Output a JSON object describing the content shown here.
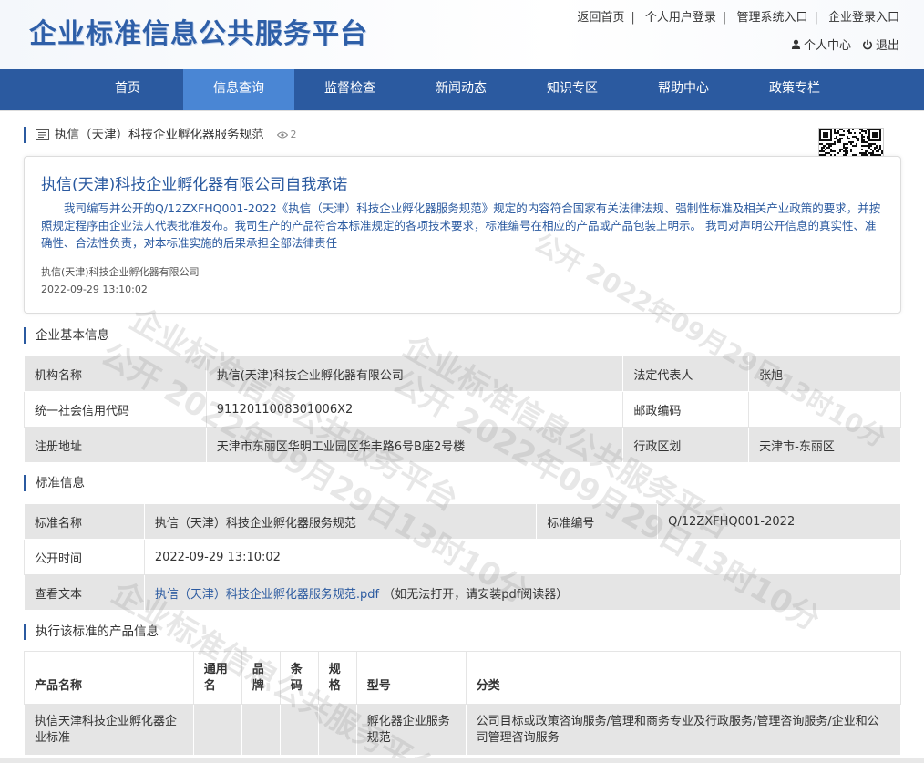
{
  "header": {
    "logo": "企业标准信息公共服务平台",
    "toplinks": [
      "返回首页",
      "个人用户登录",
      "管理系统入口",
      "企业登录入口"
    ],
    "personal_center": "个人中心",
    "logout": "退出"
  },
  "nav": {
    "items": [
      "首页",
      "信息查询",
      "监督检查",
      "新闻动态",
      "知识专区",
      "帮助中心",
      "政策专栏"
    ],
    "active": "信息查询"
  },
  "doc": {
    "title": "执信（天津）科技企业孵化器服务规范",
    "views": "2"
  },
  "pledge": {
    "title": "执信(天津)科技企业孵化器有限公司自我承诺",
    "body": "我司编写并公开的Q/12ZXFHQ001-2022《执信（天津）科技企业孵化器服务规范》规定的内容符合国家有关法律法规、强制性标准及相关产业政策的要求，并按照规定程序由企业法人代表批准发布。我司生产的产品符合本标准规定的各项技术要求，标准编号在相应的产品或产品包装上明示。 我司对声明公开信息的真实性、准确性、合法性负责，对本标准实施的后果承担全部法律责任",
    "company": "执信(天津)科技企业孵化器有限公司",
    "date": "2022-09-29 13:10:02"
  },
  "enterprise": {
    "section_title": "企业基本信息",
    "org_name_label": "机构名称",
    "org_name": "执信(天津)科技企业孵化器有限公司",
    "legal_rep_label": "法定代表人",
    "legal_rep": "张旭",
    "credit_code_label": "统一社会信用代码",
    "credit_code": "9112011008301006X2",
    "postcode_label": "邮政编码",
    "postcode": "",
    "address_label": "注册地址",
    "address": "天津市东丽区华明工业园区华丰路6号B座2号楼",
    "district_label": "行政区划",
    "district": "天津市-东丽区"
  },
  "standard": {
    "section_title": "标准信息",
    "name_label": "标准名称",
    "name": "执信（天津）科技企业孵化器服务规范",
    "number_label": "标准编号",
    "number": "Q/12ZXFHQ001-2022",
    "date_label": "公开时间",
    "date": "2022-09-29 13:10:02",
    "text_label": "查看文本",
    "pdf_link": "执信（天津）科技企业孵化器服务规范.pdf",
    "pdf_note": "（如无法打开，请安装pdf阅读器）"
  },
  "products": {
    "section_title": "执行该标准的产品信息",
    "columns": [
      "产品名称",
      "通用名",
      "品牌",
      "条码",
      "规格",
      "型号",
      "分类"
    ],
    "rows": [
      {
        "name": "执信天津科技企业孵化器企业标准",
        "common_name": "",
        "brand": "",
        "barcode": "",
        "spec": "",
        "model": "孵化器企业服务规范",
        "category": "公司目标或政策咨询服务/管理和商务专业及行政服务/管理咨询服务/企业和公司管理咨询服务"
      }
    ]
  },
  "watermark": {
    "text1": "企业标准信息公共服务平台",
    "text2": "公开 2022年09月29日13时10分"
  },
  "colors": {
    "nav_bg": "#2b5aa0",
    "nav_active": "#4a86d4",
    "accent_text": "#2b5aa0",
    "table_gray": "#e5e5e5"
  }
}
